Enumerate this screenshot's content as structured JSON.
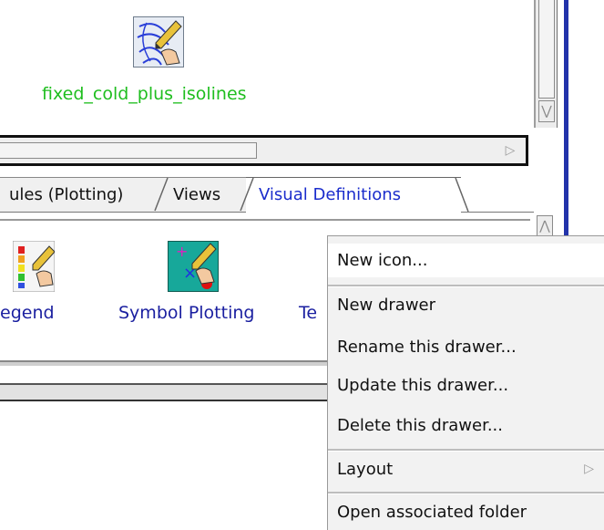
{
  "top_icon": {
    "label": "fixed_cold_plus_isolines",
    "icon": "isolines-pencil-icon"
  },
  "tabs": [
    {
      "label": "ules (Plotting)"
    },
    {
      "label": "Views"
    },
    {
      "label": "Visual Definitions",
      "active": true
    }
  ],
  "icons": [
    {
      "label": "egend",
      "icon": "legend-icon"
    },
    {
      "label": "Symbol Plotting",
      "icon": "symbol-plotting-icon"
    },
    {
      "label": "Te"
    }
  ],
  "menu": {
    "items": [
      {
        "label": "New icon..."
      },
      {
        "label": "New drawer"
      },
      {
        "label": "Rename this drawer..."
      },
      {
        "label": "Update this drawer..."
      },
      {
        "label": "Delete this drawer..."
      },
      {
        "label": "Layout",
        "submenu_arrow": "▷"
      },
      {
        "label": "Open associated folder"
      }
    ]
  },
  "scroll": {
    "up_arrow": "⋀",
    "down_arrow": "⋁",
    "right_arrow": "▷"
  },
  "colors": {
    "accent_blue": "#1a2ccc",
    "label_green": "#1fbe1f",
    "teal": "#17a89a",
    "window_border": "#2233aa"
  }
}
